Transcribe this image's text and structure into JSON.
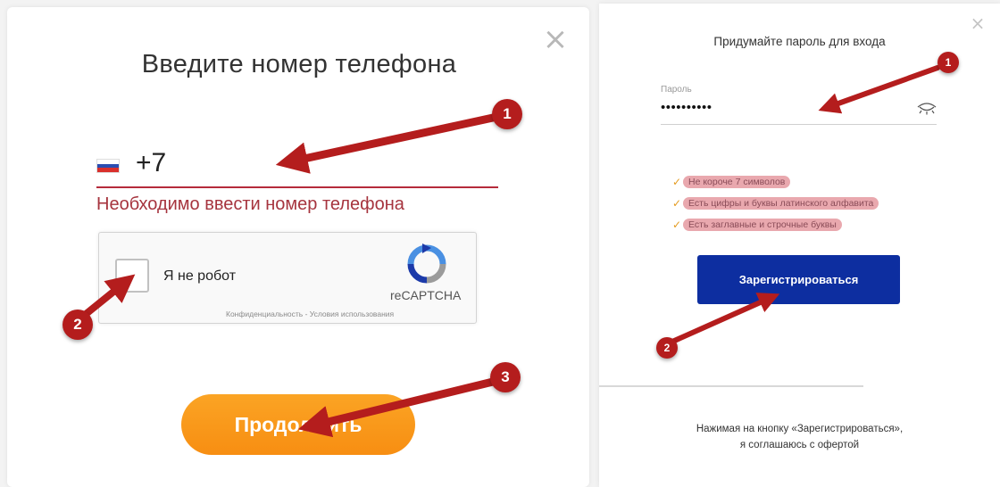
{
  "phone_modal": {
    "close_icon": "×",
    "title": "Введите номер телефона",
    "country_flag": "russia-flag-icon",
    "phone_value": "+7",
    "error_text": "Необходимо ввести номер телефона",
    "captcha": {
      "label": "Я не робот",
      "brand": "reCAPTCHA",
      "links": "Конфиденциальность - Условия использования"
    },
    "continue_label": "Продолжить"
  },
  "password_modal": {
    "close_icon": "×",
    "title": "Придумайте пароль для входа",
    "password_label": "Пароль",
    "password_value": "••••••••••",
    "requirements": [
      "Не короче 7 символов",
      "Есть цифры и буквы латинского алфавита",
      "Есть заглавные и строчные буквы"
    ],
    "register_label": "Зарегистрироваться",
    "agreement_line1": "Нажимая на кнопку «Зарегистрироваться»,",
    "agreement_line2": "я соглашаюсь с офертой"
  },
  "annotations": {
    "left_1": "1",
    "left_2": "2",
    "left_3": "3",
    "right_1": "1",
    "right_2": "2"
  },
  "colors": {
    "error": "#a6343e",
    "continue_button": "#f99a1c",
    "register_button": "#0d2ea0",
    "annotation_red": "#b41d1d",
    "requirement_highlight": "#e9a8ae",
    "check": "#e49b1f"
  }
}
